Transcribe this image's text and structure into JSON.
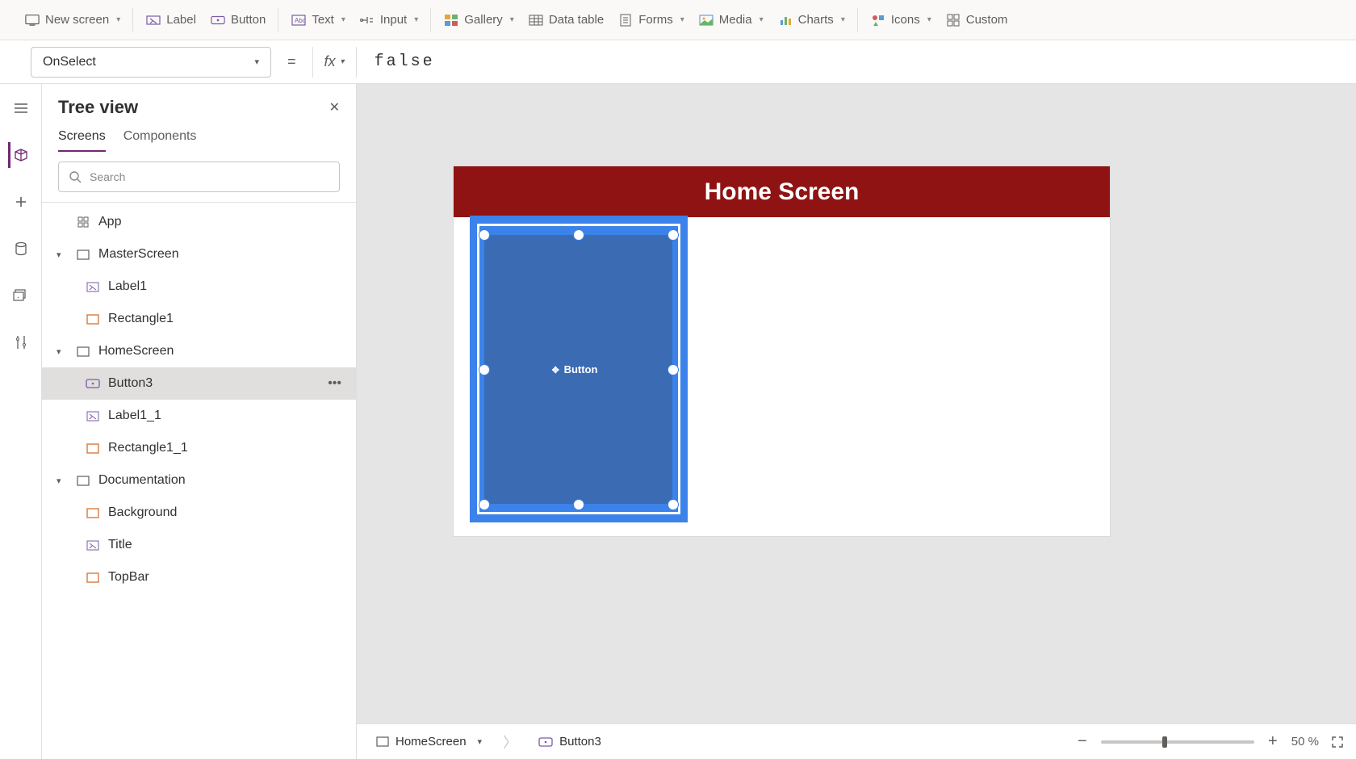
{
  "ribbon": {
    "new_screen": "New screen",
    "label": "Label",
    "button": "Button",
    "text": "Text",
    "input": "Input",
    "gallery": "Gallery",
    "data_table": "Data table",
    "forms": "Forms",
    "media": "Media",
    "charts": "Charts",
    "icons": "Icons",
    "custom": "Custom"
  },
  "formula": {
    "property": "OnSelect",
    "fx": "fx",
    "value": "false"
  },
  "tree": {
    "title": "Tree view",
    "tab_screens": "Screens",
    "tab_components": "Components",
    "search_placeholder": "Search",
    "app": "App",
    "items": [
      {
        "name": "MasterScreen",
        "children": [
          "Label1",
          "Rectangle1"
        ]
      },
      {
        "name": "HomeScreen",
        "children": [
          "Button3",
          "Label1_1",
          "Rectangle1_1"
        ]
      },
      {
        "name": "Documentation",
        "children": [
          "Background",
          "Title",
          "TopBar"
        ]
      }
    ]
  },
  "canvas": {
    "header_title": "Home Screen",
    "button_text": "Button"
  },
  "breadcrumb": {
    "screen": "HomeScreen",
    "control": "Button3"
  },
  "zoom": {
    "percent": "50",
    "suffix": "%"
  }
}
